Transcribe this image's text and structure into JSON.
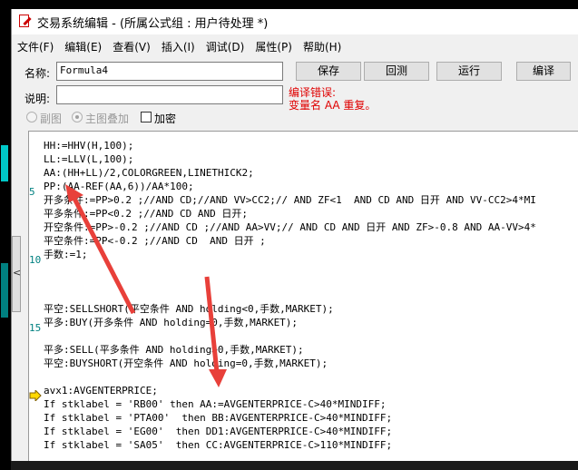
{
  "title": "交易系统编辑 - (所属公式组 : 用户待处理 *)",
  "menu": [
    "文件(F)",
    "编辑(E)",
    "查看(V)",
    "插入(I)",
    "调试(D)",
    "属性(P)",
    "帮助(H)"
  ],
  "form": {
    "name_label": "名称:",
    "name_value": "Formula4",
    "desc_label": "说明:",
    "desc_value": "",
    "save": "保存",
    "test": "回测",
    "run": "运行",
    "compile": "编译",
    "error_title": "编译错误:",
    "error_msg": "变量名 AA 重复。",
    "sub_chart": "副图",
    "main_overlay": "主图叠加",
    "encrypt": "加密"
  },
  "side_tab": "<",
  "line_numbers": [
    "5",
    "10",
    "15"
  ],
  "code": [
    "HH:=HHV(H,100);",
    "LL:=LLV(L,100);",
    "AA:(HH+LL)/2,COLORGREEN,LINETHICK2;",
    "PP:(AA-REF(AA,6))/AA*100;",
    "开多条件:=PP>0.2 ;//AND CD;//AND VV>CC2;// AND ZF<1  AND CD AND 日开 AND VV-CC2>4*MI",
    "平多条件:=PP<0.2 ;//AND CD AND 日开;",
    "开空条件:=PP>-0.2 ;//AND CD ;//AND AA>VV;// AND CD AND 日开 AND ZF>-0.8 AND AA-VV>4*",
    "平空条件:=PP<-0.2 ;//AND CD  AND 日开 ;",
    "手数:=1;",
    "",
    "",
    "",
    "",
    "平空:SELLSHORT(平空条件 AND holding<0,手数,MARKET);",
    "平多:BUY(开多条件 AND holding=0,手数,MARKET);",
    "",
    "平多:SELL(平多条件 AND holding>0,手数,MARKET);",
    "平空:BUYSHORT(开空条件 AND holding=0,手数,MARKET);",
    "",
    "avx1:AVGENTERPRICE;",
    "If stklabel = 'RB00' then AA:=AVGENTERPRICE-C>40*MINDIFF;",
    "If stklabel = 'PTA00'  then BB:AVGENTERPRICE-C>40*MINDIFF;",
    "If stklabel = 'EG00'  then DD1:AVGENTERPRICE-C>40*MINDIFF;",
    "If stklabel = 'SA05'  then CC:AVGENTERPRICE-C>110*MINDIFF;"
  ],
  "colors": {
    "arrow": "#e8403a",
    "marker": "#ffd800",
    "error": "#e00000"
  }
}
